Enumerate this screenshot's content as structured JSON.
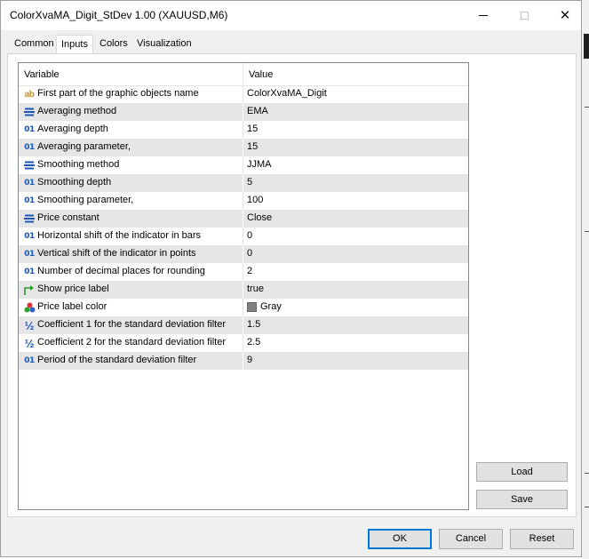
{
  "window": {
    "title": "ColorXvaMA_Digit_StDev 1.00 (XAUUSD,M6)",
    "close_symbol": "✕"
  },
  "tabs": [
    {
      "label": "Common",
      "active": false
    },
    {
      "label": "Inputs",
      "active": true
    },
    {
      "label": "Colors",
      "active": false
    },
    {
      "label": "Visualization",
      "active": false
    }
  ],
  "grid": {
    "header": {
      "variable": "Variable",
      "value": "Value"
    },
    "rows": [
      {
        "icon": "ab-string-icon",
        "icon_text": "ab",
        "variable": "First part of the graphic objects name",
        "value": "ColorXvaMA_Digit"
      },
      {
        "icon": "enum-list-icon",
        "variable": "Averaging method",
        "value": "EMA"
      },
      {
        "icon": "integer-icon",
        "icon_text": "01",
        "variable": "Averaging depth",
        "value": "15"
      },
      {
        "icon": "integer-icon",
        "icon_text": "01",
        "variable": "Averaging parameter,",
        "value": "15"
      },
      {
        "icon": "enum-list-icon",
        "variable": "Smoothing method",
        "value": "JJMA"
      },
      {
        "icon": "integer-icon",
        "icon_text": "01",
        "variable": "Smoothing depth",
        "value": "5"
      },
      {
        "icon": "integer-icon",
        "icon_text": "01",
        "variable": "Smoothing parameter,",
        "value": "100"
      },
      {
        "icon": "enum-list-icon",
        "variable": "Price constant",
        "value": "Close"
      },
      {
        "icon": "integer-icon",
        "icon_text": "01",
        "variable": "Horizontal shift of the indicator in bars",
        "value": "0"
      },
      {
        "icon": "integer-icon",
        "icon_text": "01",
        "variable": "Vertical shift of the indicator in points",
        "value": "0"
      },
      {
        "icon": "integer-icon",
        "icon_text": "01",
        "variable": "Number of decimal places for rounding",
        "value": "2"
      },
      {
        "icon": "bool-arrow-icon",
        "variable": "Show price label",
        "value": "true"
      },
      {
        "icon": "color-palette-icon",
        "variable": "Price label color",
        "value": "Gray",
        "swatch": "#808080"
      },
      {
        "icon": "double-fraction-icon",
        "icon_text": "½",
        "variable": "Coefficient 1 for the standard deviation filter",
        "value": "1.5"
      },
      {
        "icon": "double-fraction-icon",
        "icon_text": "½",
        "variable": "Coefficient 2 for the standard deviation filter",
        "value": "2.5"
      },
      {
        "icon": "integer-icon",
        "icon_text": "01",
        "variable": "Period of the standard deviation filter",
        "value": "9"
      }
    ]
  },
  "side_buttons": {
    "load": "Load",
    "save": "Save"
  },
  "footer_buttons": {
    "ok": "OK",
    "cancel": "Cancel",
    "reset": "Reset"
  },
  "colors": {
    "shaded_row": "#e6e6e6",
    "ok_border": "#0078d7",
    "integer_icon": "#1a55b8",
    "string_icon": "#c8902a"
  }
}
